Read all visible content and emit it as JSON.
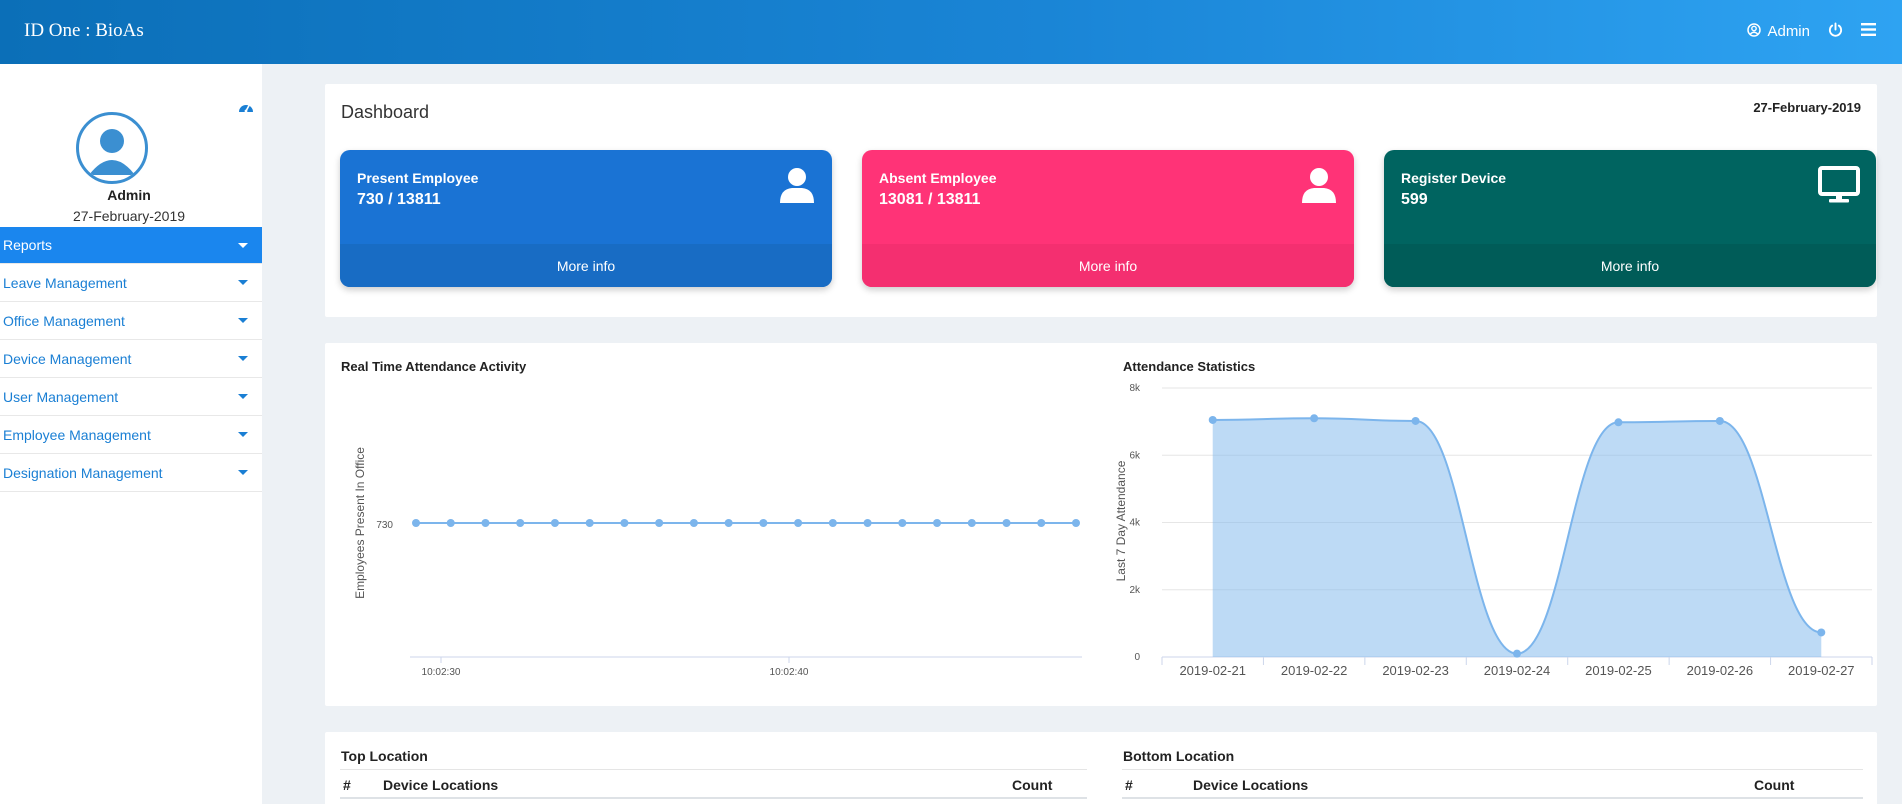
{
  "app": {
    "title": "ID One : BioAs"
  },
  "navbar": {
    "user_label": "Admin"
  },
  "sidebar": {
    "user_name": "Admin",
    "date": "27-February-2019",
    "items": [
      {
        "label": "Reports",
        "active": true
      },
      {
        "label": "Leave Management"
      },
      {
        "label": "Office Management"
      },
      {
        "label": "Device Management"
      },
      {
        "label": "User Management"
      },
      {
        "label": "Employee Management"
      },
      {
        "label": "Designation Management"
      }
    ]
  },
  "dashboard": {
    "title": "Dashboard",
    "date": "27-February-2019",
    "cards": [
      {
        "label": "Present Employee",
        "value": "730 / 13811",
        "footer": "More info",
        "color": "#1a73d4",
        "icon": "user-icon"
      },
      {
        "label": "Absent Employee",
        "value": "13081 / 13811",
        "footer": "More info",
        "color": "#ff3377",
        "icon": "user-icon"
      },
      {
        "label": "Register Device",
        "value": "599",
        "footer": "More info",
        "color": "#006460",
        "icon": "monitor-icon"
      }
    ]
  },
  "chart_data": [
    {
      "type": "line",
      "title": "Real Time Attendance Activity",
      "ylabel": "Employees Present In Office",
      "ytick_label": "730",
      "xtick_labels": [
        "10:02:30",
        "10:02:40"
      ],
      "values": [
        730,
        730,
        730,
        730,
        730,
        730,
        730,
        730,
        730,
        730,
        730,
        730,
        730,
        730,
        730,
        730,
        730,
        730,
        730,
        730
      ],
      "color": "#7cb5ec"
    },
    {
      "type": "area",
      "title": "Attendance Statistics",
      "ylabel": "Last 7 Day Attendance",
      "categories": [
        "2019-02-21",
        "2019-02-22",
        "2019-02-23",
        "2019-02-24",
        "2019-02-25",
        "2019-02-26",
        "2019-02-27"
      ],
      "values": [
        7050,
        7100,
        7020,
        100,
        6980,
        7020,
        730
      ],
      "ylim": [
        0,
        8000
      ],
      "ytick_labels": [
        "0",
        "2k",
        "4k",
        "6k",
        "8k"
      ],
      "grid": true,
      "color": "#7cb5ec"
    }
  ],
  "tables": {
    "top": {
      "title": "Top Location",
      "columns": [
        "#",
        "Device Locations",
        "Count"
      ]
    },
    "bottom": {
      "title": "Bottom Location",
      "columns": [
        "#",
        "Device Locations",
        "Count"
      ]
    }
  }
}
